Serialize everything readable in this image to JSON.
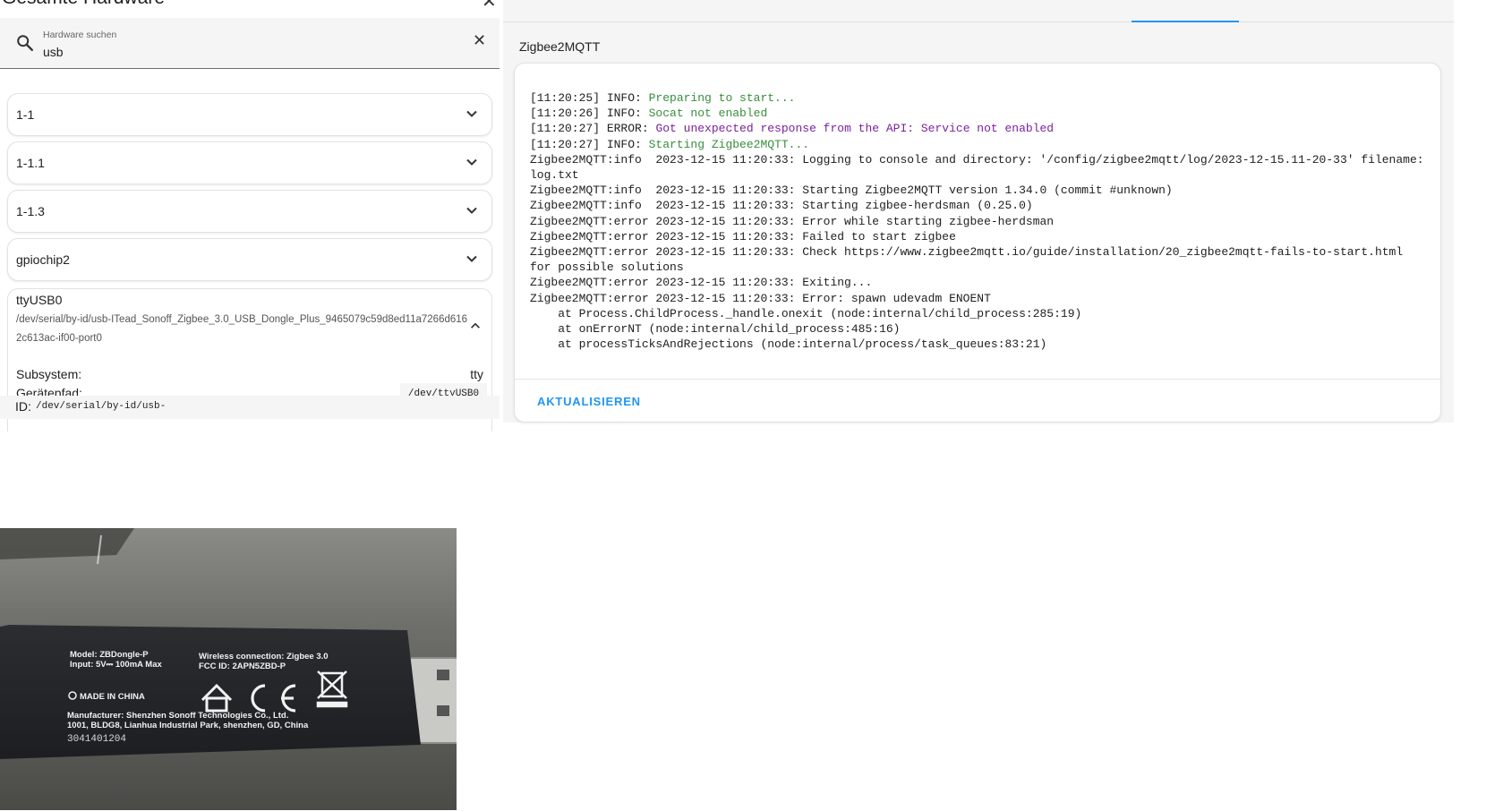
{
  "hardware_dialog": {
    "title": "Gesamte Hardware",
    "search": {
      "label": "Hardware suchen",
      "value": "usb"
    },
    "devices": [
      {
        "name": "1-1"
      },
      {
        "name": "1-1.1"
      },
      {
        "name": "1-1.3"
      },
      {
        "name": "gpiochip2"
      }
    ],
    "expanded_device": {
      "name": "ttyUSB0",
      "by_id_path": "/dev/serial/by-id/usb-ITead_Sonoff_Zigbee_3.0_USB_Dongle_Plus_9465079c59d8ed11a7266d6162c613ac-if00-port0",
      "subsystem_label": "Subsystem:",
      "subsystem_value": "tty",
      "device_path_label": "Gerätepfad:",
      "device_path_value": "/dev/ttyUSB0",
      "id_label": "ID:",
      "id_value": "/dev/serial/by-id/usb-"
    }
  },
  "log_panel": {
    "addon_title": "Zigbee2MQTT",
    "refresh_label": "AKTUALISIEREN",
    "lines": [
      {
        "prefix": "[11:20:25] INFO: ",
        "text": "Preparing to start...",
        "color": "green"
      },
      {
        "prefix": "[11:20:26] INFO: ",
        "text": "Socat not enabled",
        "color": "green"
      },
      {
        "prefix": "[11:20:27] ERROR: ",
        "text": "Got unexpected response from the API: Service not enabled",
        "color": "purple"
      },
      {
        "prefix": "[11:20:27] INFO: ",
        "text": "Starting Zigbee2MQTT...",
        "color": "green"
      },
      {
        "prefix": "",
        "text": "Zigbee2MQTT:info  2023-12-15 11:20:33: Logging to console and directory: '/config/zigbee2mqtt/log/2023-12-15.11-20-33' filename: log.txt",
        "color": "default"
      },
      {
        "prefix": "",
        "text": "Zigbee2MQTT:info  2023-12-15 11:20:33: Starting Zigbee2MQTT version 1.34.0 (commit #unknown)",
        "color": "default"
      },
      {
        "prefix": "",
        "text": "Zigbee2MQTT:info  2023-12-15 11:20:33: Starting zigbee-herdsman (0.25.0)",
        "color": "default"
      },
      {
        "prefix": "",
        "text": "Zigbee2MQTT:error 2023-12-15 11:20:33: Error while starting zigbee-herdsman",
        "color": "default"
      },
      {
        "prefix": "",
        "text": "Zigbee2MQTT:error 2023-12-15 11:20:33: Failed to start zigbee",
        "color": "default"
      },
      {
        "prefix": "",
        "text": "Zigbee2MQTT:error 2023-12-15 11:20:33: Check https://www.zigbee2mqtt.io/guide/installation/20_zigbee2mqtt-fails-to-start.html for possible solutions",
        "color": "default"
      },
      {
        "prefix": "",
        "text": "Zigbee2MQTT:error 2023-12-15 11:20:33: Exiting...",
        "color": "default"
      },
      {
        "prefix": "",
        "text": "Zigbee2MQTT:error 2023-12-15 11:20:33: Error: spawn udevadm ENOENT",
        "color": "default"
      },
      {
        "prefix": "",
        "text": "    at Process.ChildProcess._handle.onexit (node:internal/child_process:285:19)",
        "color": "default"
      },
      {
        "prefix": "",
        "text": "    at onErrorNT (node:internal/child_process:485:16)",
        "color": "default"
      },
      {
        "prefix": "",
        "text": "    at processTicksAndRejections (node:internal/process/task_queues:83:21)",
        "color": "default"
      }
    ]
  },
  "dongle_label": {
    "model": "Model: ZBDongle-P",
    "input": "Input: 5V⎓  100mA Max",
    "wireless": "Wireless connection: Zigbee 3.0",
    "fcc": "FCC ID: 2APN5ZBD-P",
    "made_in": "MADE IN CHINA",
    "manufacturer_line1": "Manufacturer: Shenzhen Sonoff Technologies Co., Ltd.",
    "manufacturer_line2": "1001, BLDG8, Lianhua Industrial Park, shenzhen, GD, China",
    "serial": "3041401204"
  },
  "colors": {
    "accent": "#2196f3",
    "log_info": "#388e3c",
    "log_error": "#7b1fa2",
    "card_border": "#e2e2e2",
    "panel_bg": "#f5f5f5"
  },
  "icons": [
    "close-icon",
    "search-icon",
    "clear-icon",
    "chevron-down-icon",
    "chevron-up-icon",
    "home-icon",
    "ce-mark-icon",
    "weee-bin-icon"
  ]
}
